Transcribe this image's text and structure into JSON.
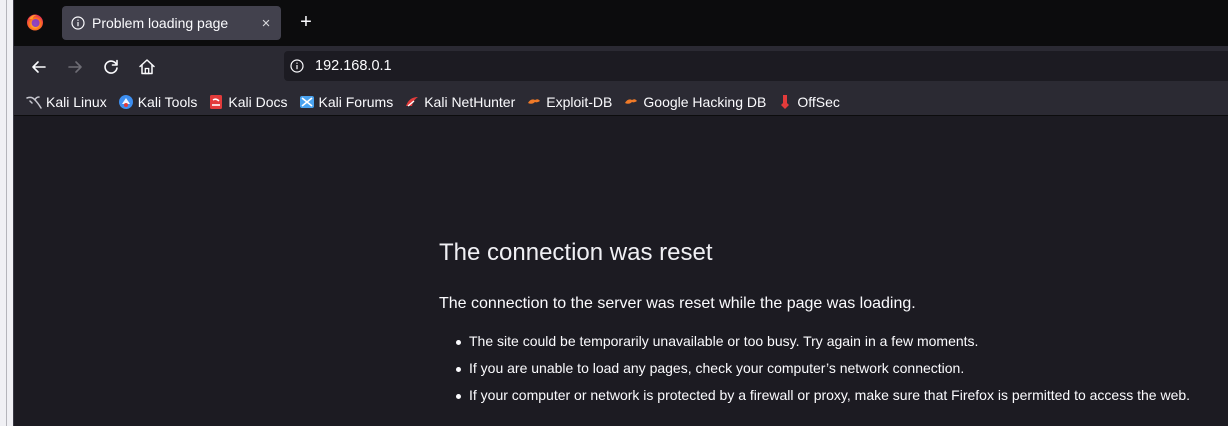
{
  "browser": {
    "tab": {
      "title": "Problem loading page",
      "close_glyph": "×"
    },
    "new_tab_glyph": "+",
    "url": "192.168.0.1"
  },
  "bookmarks": [
    {
      "label": "Kali Linux",
      "icon": "kali-dragon-icon",
      "color": "#c8c8d0"
    },
    {
      "label": "Kali Tools",
      "icon": "kali-tools-icon",
      "color": "#3d8ef0"
    },
    {
      "label": "Kali Docs",
      "icon": "kali-docs-icon",
      "color": "#e23b3b"
    },
    {
      "label": "Kali Forums",
      "icon": "kali-forums-icon",
      "color": "#4aa3f0"
    },
    {
      "label": "Kali NetHunter",
      "icon": "kali-nethunter-icon",
      "color": "#e23b3b"
    },
    {
      "label": "Exploit-DB",
      "icon": "exploit-db-icon",
      "color": "#f07a28"
    },
    {
      "label": "Google Hacking DB",
      "icon": "ghdb-icon",
      "color": "#f07a28"
    },
    {
      "label": "OffSec",
      "icon": "offsec-icon",
      "color": "#e23b3b"
    }
  ],
  "error": {
    "title": "The connection was reset",
    "description": "The connection to the server was reset while the page was loading.",
    "items": [
      "The site could be temporarily unavailable or too busy. Try again in a few moments.",
      "If you are unable to load any pages, check your computer’s network connection.",
      "If your computer or network is protected by a firewall or proxy, make sure that Firefox is permitted to access the web."
    ]
  },
  "colors": {
    "tabstrip": "#0c0c0d",
    "toolbar": "#2b2a33",
    "content_bg": "#1c1b22",
    "text": "#fbfbfe"
  }
}
